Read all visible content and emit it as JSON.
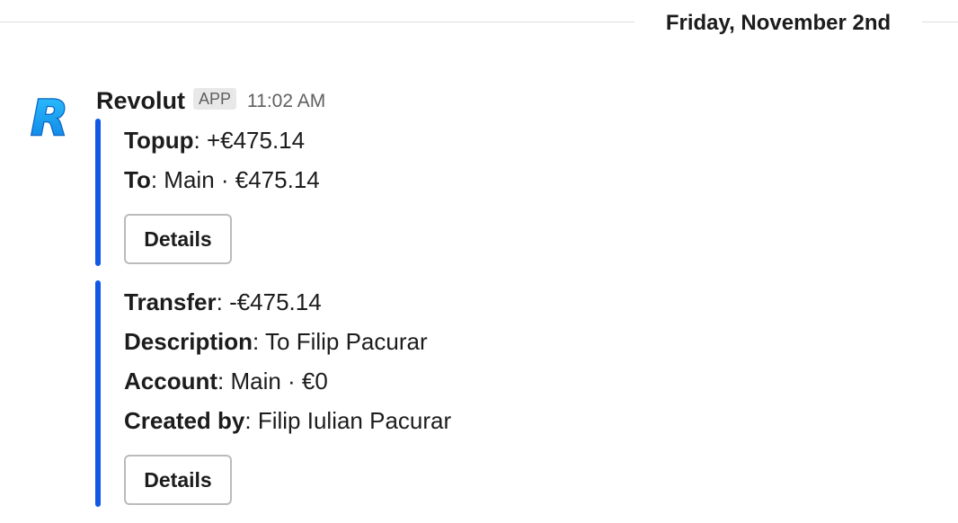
{
  "day_divider": {
    "label": "Friday, November 2nd"
  },
  "message": {
    "sender": "Revolut",
    "badge": "APP",
    "time": "11:02 AM",
    "avatar_icon": "revolut-logo-icon",
    "accent_color": "#0f59e6"
  },
  "attachments": [
    {
      "fields": [
        {
          "key": "Topup",
          "sep": ": ",
          "value": "+€475.14"
        },
        {
          "key": "To",
          "sep": ": ",
          "value": "Main · €475.14"
        }
      ],
      "button_label": "Details"
    },
    {
      "fields": [
        {
          "key": "Transfer",
          "sep": ": ",
          "value": "-€475.14"
        },
        {
          "key": "Description",
          "sep": ": ",
          "value": "To Filip Pacurar"
        },
        {
          "key": "Account",
          "sep": ": ",
          "value": "Main · €0"
        },
        {
          "key": "Created by",
          "sep": ": ",
          "value": "Filip Iulian Pacurar"
        }
      ],
      "button_label": "Details"
    }
  ]
}
